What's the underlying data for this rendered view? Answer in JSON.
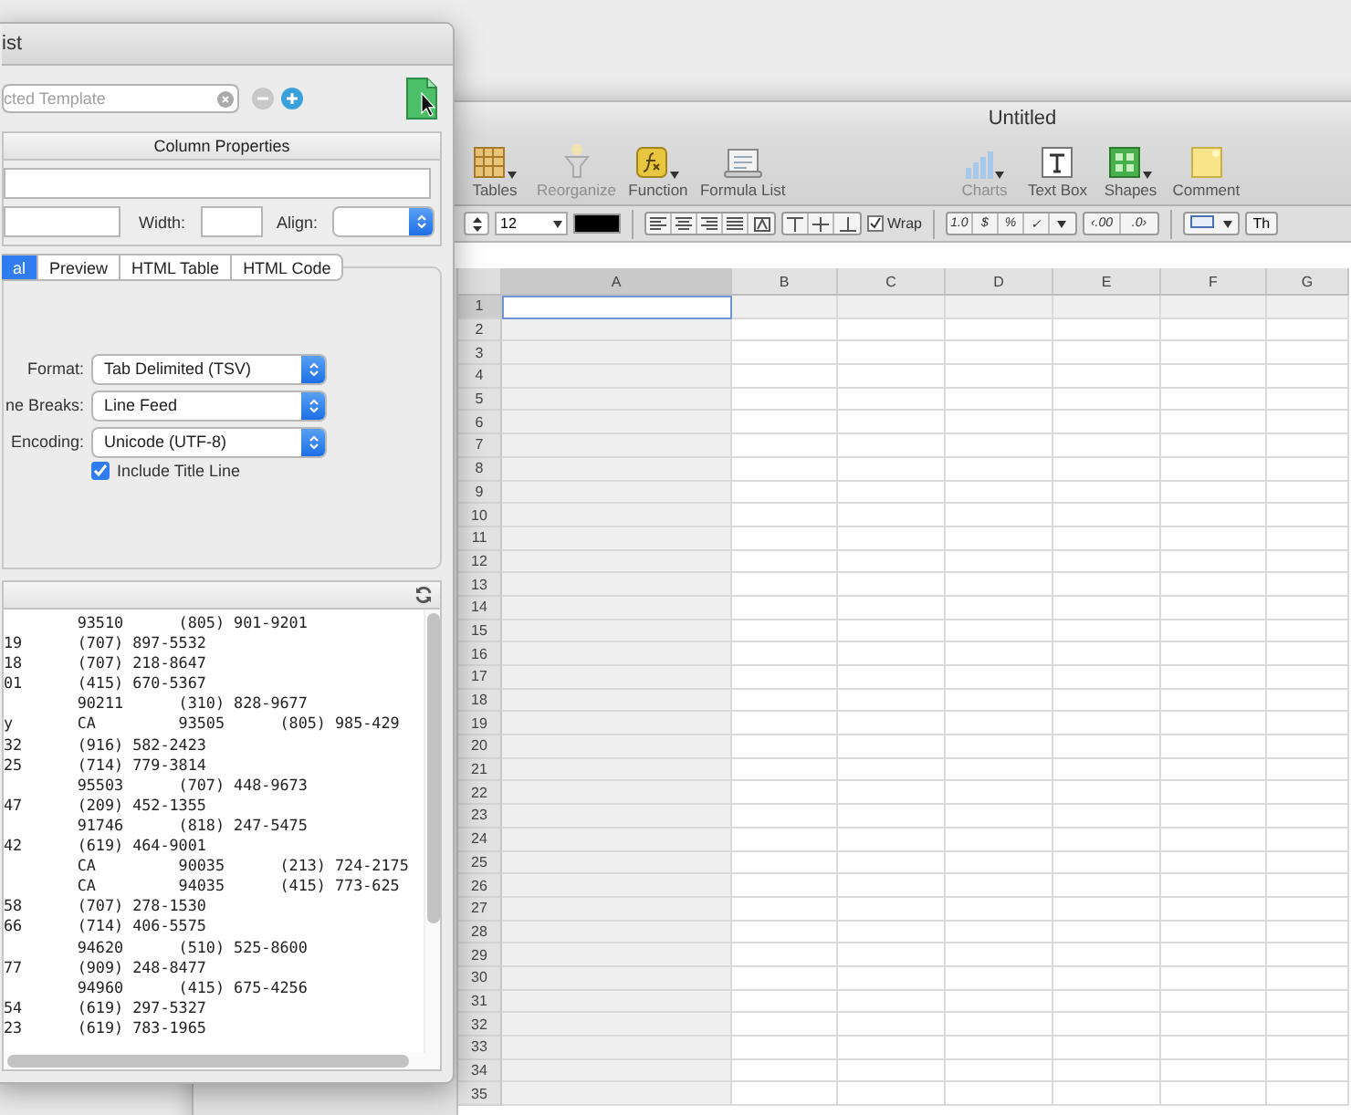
{
  "dialog": {
    "title": "ist",
    "template_search": {
      "placeholder": "cted Template"
    },
    "column_properties": {
      "title": "Column Properties",
      "width_label": "Width:",
      "align_label": "Align:"
    },
    "tabs": [
      {
        "label": "al",
        "selected": true
      },
      {
        "label": "Preview",
        "selected": false
      },
      {
        "label": "HTML Table",
        "selected": false
      },
      {
        "label": "HTML Code",
        "selected": false
      }
    ],
    "export_options": [
      {
        "label": "Format:",
        "value": "Tab Delimited (TSV)"
      },
      {
        "label": "ne Breaks:",
        "value": "Line Feed"
      },
      {
        "label": "Encoding:",
        "value": "Unicode (UTF-8)"
      }
    ],
    "include_title_line": {
      "label": "Include Title Line",
      "checked": true
    },
    "preview_lines": [
      "        93510      (805) 901-9201",
      "19      (707) 897-5532",
      "18      (707) 218-8647",
      "01      (415) 670-5367",
      "        90211      (310) 828-9677",
      "y       CA         93505      (805) 985-429",
      "32      (916) 582-2423",
      "25      (714) 779-3814",
      "        95503      (707) 448-9673",
      "47      (209) 452-1355",
      "        91746      (818) 247-5475",
      "42      (619) 464-9001",
      "        CA         90035      (213) 724-2175",
      "        CA         94035      (415) 773-625",
      "58      (707) 278-1530",
      "66      (714) 406-5575",
      "        94620      (510) 525-8600",
      "77      (909) 248-8477",
      "        94960      (415) 675-4256",
      "54      (619) 297-5327",
      "23      (619) 783-1965"
    ]
  },
  "spreadsheet": {
    "title": "Untitled",
    "toolbar_left": [
      {
        "label": "Tables",
        "kind": "tables",
        "disabled": false,
        "menu": true
      },
      {
        "label": "Reorganize",
        "kind": "reorganize",
        "disabled": true,
        "menu": false
      },
      {
        "label": "Function",
        "kind": "function",
        "disabled": false,
        "menu": true
      },
      {
        "label": "Formula List",
        "kind": "formula-list",
        "disabled": false,
        "menu": false
      }
    ],
    "toolbar_right": [
      {
        "label": "Charts",
        "kind": "charts",
        "disabled": true,
        "menu": true
      },
      {
        "label": "Text Box",
        "kind": "text-box",
        "disabled": false,
        "menu": false
      },
      {
        "label": "Shapes",
        "kind": "shapes",
        "disabled": false,
        "menu": true
      },
      {
        "label": "Comment",
        "kind": "comment",
        "disabled": false,
        "menu": false
      }
    ],
    "format_bar": {
      "font_size": "12",
      "wrap": {
        "label": "Wrap",
        "checked": true
      },
      "number_formats": [
        "1.0",
        "$",
        "%",
        "✓"
      ],
      "decimal_buttons": [
        "‹.00",
        ".0›"
      ],
      "cut_button": "Th"
    },
    "columns": [
      {
        "label": "A",
        "selected": true
      },
      {
        "label": "B",
        "selected": false
      },
      {
        "label": "C",
        "selected": false
      },
      {
        "label": "D",
        "selected": false
      },
      {
        "label": "E",
        "selected": false
      },
      {
        "label": "F",
        "selected": false
      },
      {
        "label": "G",
        "selected": false
      }
    ],
    "rows": [
      {
        "label": "1",
        "selected": true
      },
      {
        "label": "2",
        "selected": false
      },
      {
        "label": "3",
        "selected": false
      },
      {
        "label": "4",
        "selected": false
      },
      {
        "label": "5",
        "selected": false
      },
      {
        "label": "6",
        "selected": false
      },
      {
        "label": "7",
        "selected": false
      },
      {
        "label": "8",
        "selected": false
      },
      {
        "label": "9",
        "selected": false
      },
      {
        "label": "10",
        "selected": false
      },
      {
        "label": "11",
        "selected": false
      },
      {
        "label": "12",
        "selected": false
      },
      {
        "label": "13",
        "selected": false
      },
      {
        "label": "14",
        "selected": false
      },
      {
        "label": "15",
        "selected": false
      },
      {
        "label": "16",
        "selected": false
      },
      {
        "label": "17",
        "selected": false
      },
      {
        "label": "18",
        "selected": false
      },
      {
        "label": "19",
        "selected": false
      },
      {
        "label": "20",
        "selected": false
      },
      {
        "label": "21",
        "selected": false
      },
      {
        "label": "22",
        "selected": false
      },
      {
        "label": "23",
        "selected": false
      },
      {
        "label": "24",
        "selected": false
      },
      {
        "label": "25",
        "selected": false
      },
      {
        "label": "26",
        "selected": false
      },
      {
        "label": "27",
        "selected": false
      },
      {
        "label": "28",
        "selected": false
      },
      {
        "label": "29",
        "selected": false
      },
      {
        "label": "30",
        "selected": false
      },
      {
        "label": "31",
        "selected": false
      },
      {
        "label": "32",
        "selected": false
      },
      {
        "label": "33",
        "selected": false
      },
      {
        "label": "34",
        "selected": false
      },
      {
        "label": "35",
        "selected": false
      }
    ]
  }
}
